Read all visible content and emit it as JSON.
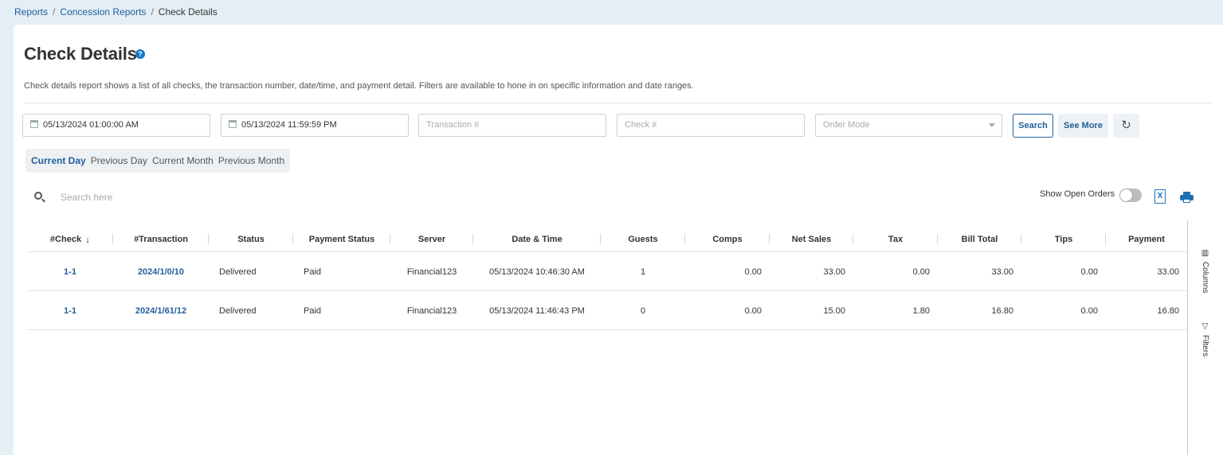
{
  "breadcrumb": {
    "items": [
      "Reports",
      "Concession Reports",
      "Check Details"
    ],
    "separator": "/"
  },
  "page": {
    "title": "Check Details",
    "help_icon": "question-circle-icon",
    "description": "Check details report shows a list of all checks, the transaction number, date/time, and payment detail. Filters are available to hone in on specific information and date ranges."
  },
  "filters": {
    "start_date": "05/13/2024 01:00:00 AM",
    "end_date": "05/13/2024 11:59:59 PM",
    "transaction_placeholder": "Transaction #",
    "check_placeholder": "Check #",
    "order_mode_placeholder": "Order Mode",
    "search_label": "Search",
    "see_more_label": "See More",
    "reset_icon": "refresh-icon"
  },
  "quick_ranges": {
    "items": [
      "Current Day",
      "Previous Day",
      "Current Month",
      "Previous Month"
    ],
    "active": "Current Day"
  },
  "toolbar": {
    "search_placeholder": "Search here",
    "show_open_orders_label": "Show Open Orders",
    "show_open_orders": false,
    "excel_icon_text": "X"
  },
  "table": {
    "columns": [
      "#Check",
      "#Transaction",
      "Status",
      "Payment Status",
      "Server",
      "Date & Time",
      "Guests",
      "Comps",
      "Net Sales",
      "Tax",
      "Bill Total",
      "Tips",
      "Payment"
    ],
    "sorted_column": "#Check",
    "sort_direction": "descending",
    "rows": [
      [
        "1-1",
        "2024/1/0/10",
        "Delivered",
        "Paid",
        "Financial123",
        "05/13/2024 10:46:30 AM",
        "1",
        "0.00",
        "33.00",
        "0.00",
        "33.00",
        "0.00",
        "33.00"
      ],
      [
        "1-1",
        "2024/1/61/12",
        "Delivered",
        "Paid",
        "Financial123",
        "05/13/2024 11:46:43 PM",
        "0",
        "0.00",
        "15.00",
        "1.80",
        "16.80",
        "0.00",
        "16.80"
      ]
    ]
  },
  "side_panel": {
    "columns_label": "Columns",
    "filters_label": "Filters"
  },
  "colors": {
    "link": "#1f5f9a",
    "background": "#e3eef5",
    "accent_icon": "#1f6fb5"
  }
}
